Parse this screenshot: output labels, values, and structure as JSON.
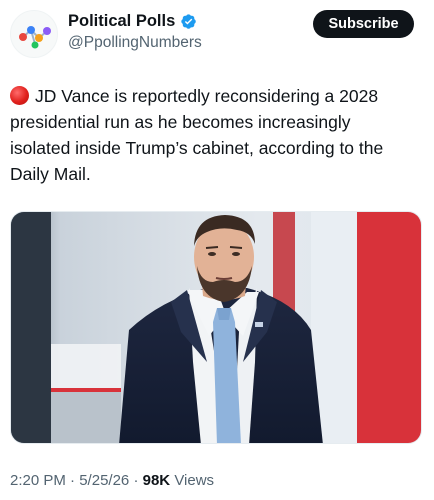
{
  "author": {
    "display_name": "Political Polls",
    "handle": "@PpollingNumbers",
    "verified": true,
    "avatar_icon": "colorful-dots-logo"
  },
  "subscribe_label": "Subscribe",
  "post": {
    "emoji": "red-circle",
    "text": "JD Vance is reportedly reconsidering a 2028 presidential run as he becomes increasingly isolated inside Trump’s cabinet, according to the Daily Mail."
  },
  "media": {
    "type": "photo"
  },
  "meta": {
    "time": "2:20 PM",
    "date": "5/25/26",
    "views_count": "98K",
    "views_label": "Views",
    "separator": "·"
  },
  "colors": {
    "text": "#0f1419",
    "secondary": "#536471",
    "verified": "#1d9bf0",
    "button_bg": "#0f1419"
  }
}
